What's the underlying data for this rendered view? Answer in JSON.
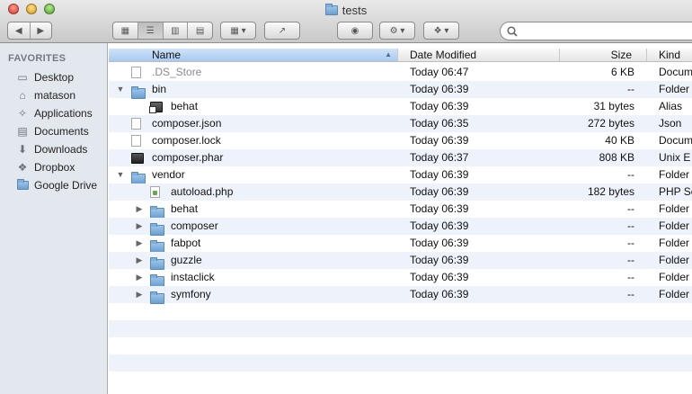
{
  "window": {
    "title": "tests"
  },
  "toolbar": {
    "back_icon": "back-arrow-icon",
    "forward_icon": "forward-arrow-icon",
    "view_modes": [
      "icon-view-icon",
      "list-view-icon",
      "column-view-icon",
      "coverflow-view-icon"
    ],
    "active_view": "list",
    "arrange_icon": "arrange-grid-icon",
    "share_icon": "share-icon",
    "quicklook_icon": "eye-icon",
    "action_icon": "gear-icon",
    "dropbox_icon": "dropbox-icon",
    "search": {
      "placeholder": "",
      "value": "",
      "icon": "search-icon"
    }
  },
  "sidebar": {
    "heading": "FAVORITES",
    "items": [
      {
        "label": "Desktop",
        "icon": "desktop-icon"
      },
      {
        "label": "matason",
        "icon": "home-icon"
      },
      {
        "label": "Applications",
        "icon": "applications-icon"
      },
      {
        "label": "Documents",
        "icon": "documents-icon"
      },
      {
        "label": "Downloads",
        "icon": "downloads-icon"
      },
      {
        "label": "Dropbox",
        "icon": "dropbox-icon"
      },
      {
        "label": "Google Drive",
        "icon": "folder-icon"
      }
    ]
  },
  "columns": {
    "name": "Name",
    "date": "Date Modified",
    "size": "Size",
    "kind": "Kind"
  },
  "files": [
    {
      "name": ".DS_Store",
      "date": "Today 06:47",
      "size": "6 KB",
      "kind": "Docum",
      "depth": 0,
      "icon": "document-icon",
      "disclosure": "none",
      "dimmed": true
    },
    {
      "name": "bin",
      "date": "Today 06:39",
      "size": "--",
      "kind": "Folder",
      "depth": 0,
      "icon": "folder-icon",
      "disclosure": "open"
    },
    {
      "name": "behat",
      "date": "Today 06:39",
      "size": "31 bytes",
      "kind": "Alias",
      "depth": 1,
      "icon": "alias-icon",
      "disclosure": "none"
    },
    {
      "name": "composer.json",
      "date": "Today 06:35",
      "size": "272 bytes",
      "kind": "Json",
      "depth": 0,
      "icon": "document-icon",
      "disclosure": "none"
    },
    {
      "name": "composer.lock",
      "date": "Today 06:39",
      "size": "40 KB",
      "kind": "Docum",
      "depth": 0,
      "icon": "document-icon",
      "disclosure": "none"
    },
    {
      "name": "composer.phar",
      "date": "Today 06:37",
      "size": "808 KB",
      "kind": "Unix E",
      "depth": 0,
      "icon": "executable-icon",
      "disclosure": "none"
    },
    {
      "name": "vendor",
      "date": "Today 06:39",
      "size": "--",
      "kind": "Folder",
      "depth": 0,
      "icon": "folder-icon",
      "disclosure": "open"
    },
    {
      "name": "autoload.php",
      "date": "Today 06:39",
      "size": "182 bytes",
      "kind": "PHP Sc",
      "depth": 1,
      "icon": "php-file-icon",
      "disclosure": "none"
    },
    {
      "name": "behat",
      "date": "Today 06:39",
      "size": "--",
      "kind": "Folder",
      "depth": 1,
      "icon": "folder-icon",
      "disclosure": "closed"
    },
    {
      "name": "composer",
      "date": "Today 06:39",
      "size": "--",
      "kind": "Folder",
      "depth": 1,
      "icon": "folder-icon",
      "disclosure": "closed"
    },
    {
      "name": "fabpot",
      "date": "Today 06:39",
      "size": "--",
      "kind": "Folder",
      "depth": 1,
      "icon": "folder-icon",
      "disclosure": "closed"
    },
    {
      "name": "guzzle",
      "date": "Today 06:39",
      "size": "--",
      "kind": "Folder",
      "depth": 1,
      "icon": "folder-icon",
      "disclosure": "closed"
    },
    {
      "name": "instaclick",
      "date": "Today 06:39",
      "size": "--",
      "kind": "Folder",
      "depth": 1,
      "icon": "folder-icon",
      "disclosure": "closed"
    },
    {
      "name": "symfony",
      "date": "Today 06:39",
      "size": "--",
      "kind": "Folder",
      "depth": 1,
      "icon": "folder-icon",
      "disclosure": "closed"
    }
  ],
  "colors": {
    "sidebar_bg": "#e3e8ee",
    "alt_row": "#eef3fb",
    "header_sorted": "#a8c9ef",
    "folder": "#7fb0dc"
  }
}
